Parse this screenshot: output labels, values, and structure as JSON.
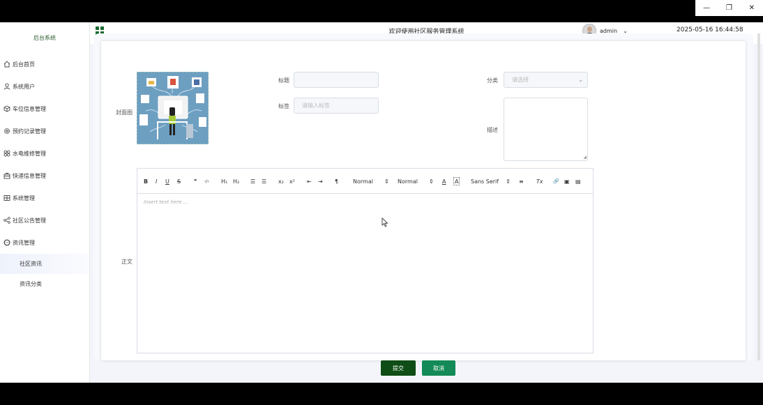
{
  "window": {
    "minimize": "—",
    "restore": "❐",
    "close": "✕"
  },
  "sidebar": {
    "brand": "后台系统",
    "items": [
      {
        "label": "后台首页",
        "icon": "home-icon"
      },
      {
        "label": "系统用户",
        "icon": "user-icon"
      },
      {
        "label": "车位信息管理",
        "icon": "box-icon"
      },
      {
        "label": "预约记录管理",
        "icon": "gear-icon"
      },
      {
        "label": "水电维修管理",
        "icon": "link-icon"
      },
      {
        "label": "快递信息管理",
        "icon": "briefcase-icon"
      },
      {
        "label": "系统管理",
        "icon": "grid-icon"
      },
      {
        "label": "社区公告管理",
        "icon": "share-icon"
      },
      {
        "label": "资讯管理",
        "icon": "chat-icon"
      }
    ],
    "subitems": [
      {
        "label": "社区资讯",
        "active": true
      },
      {
        "label": "资讯分类",
        "active": false
      }
    ]
  },
  "header": {
    "title": "欢迎使用社区服务管理系统",
    "user": "admin",
    "datetime": "2025-05-16 16:44:58",
    "accent": "#1a6b2e"
  },
  "form": {
    "cover_label": "封面图",
    "title_label": "标题",
    "title_value": "",
    "tags_label": "标签",
    "tags_placeholder": "请输入标签",
    "category_label": "分类",
    "category_placeholder": "请选择",
    "desc_label": "描述",
    "body_label": "正文",
    "editor_placeholder": "Insert text here ...",
    "toolbar": {
      "bold": "B",
      "italic": "I",
      "underline": "U",
      "strike": "S",
      "quote": "❞",
      "code": "‹/›",
      "h1": "H₁",
      "h2": "H₂",
      "ordered": "☰",
      "bullet": "☰",
      "sub": "x₂",
      "sup": "x²",
      "outdent": "⇤",
      "indent": "⇥",
      "rtl": "¶",
      "size": "Normal",
      "header": "Normal",
      "color": "A",
      "bg": "A",
      "font": "Sans Serif",
      "align": "≡",
      "clean": "Tx",
      "link": "🔗",
      "image": "▣",
      "video": "▤"
    },
    "submit": "提交",
    "cancel": "取消"
  }
}
